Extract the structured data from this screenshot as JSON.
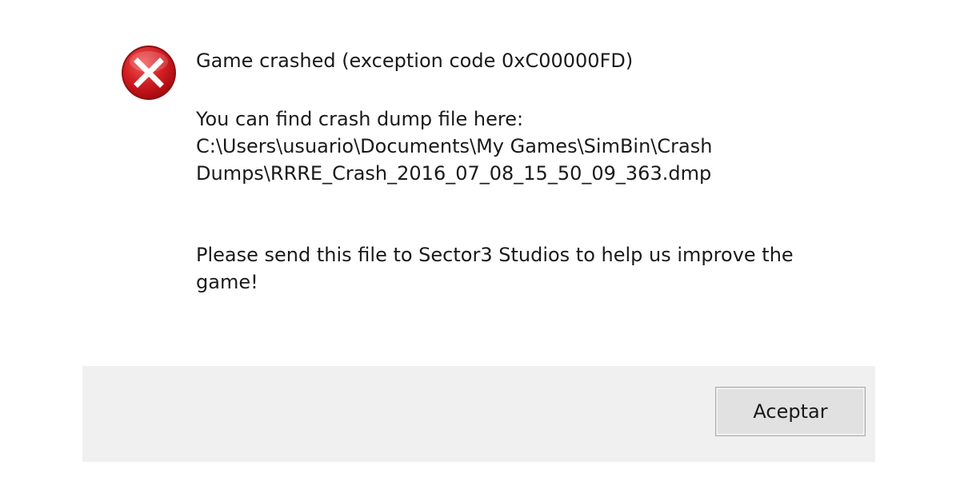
{
  "icon": "error-x-icon",
  "colors": {
    "icon_red": "#c8181c",
    "footer_bg": "#f0f0f0",
    "button_bg": "#e1e1e1",
    "text": "#1a1a1a"
  },
  "message": {
    "headline": "Game crashed (exception code 0xC00000FD)",
    "detail_lines": [
      "You can find crash dump file here:",
      "C:\\Users\\usuario\\Documents\\My Games\\SimBin\\Crash",
      "Dumps\\RRRE_Crash_2016_07_08_15_50_09_363.dmp"
    ],
    "request_lines": [
      "Please send this file to Sector3 Studios to help us improve the",
      "game!"
    ]
  },
  "footer": {
    "ok_button_label": "Aceptar"
  }
}
